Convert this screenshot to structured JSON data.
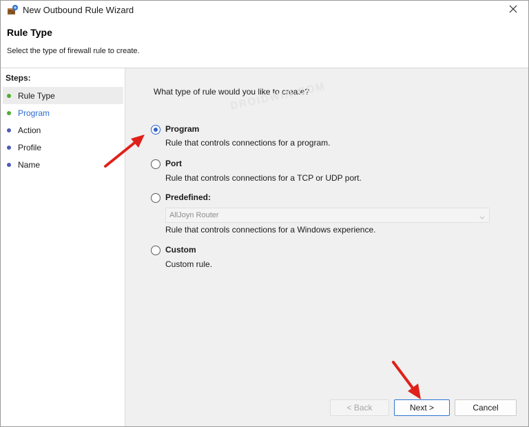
{
  "window": {
    "title": "New Outbound Rule Wizard"
  },
  "header": {
    "title": "Rule Type",
    "subtitle": "Select the type of firewall rule to create."
  },
  "steps": {
    "label": "Steps:",
    "items": [
      {
        "label": "Rule Type",
        "status": "current"
      },
      {
        "label": "Program",
        "status": "next"
      },
      {
        "label": "Action",
        "status": "pending"
      },
      {
        "label": "Profile",
        "status": "pending"
      },
      {
        "label": "Name",
        "status": "pending"
      }
    ]
  },
  "content": {
    "question": "What type of rule would you like to create?",
    "watermark": "DROIDWIN.COM",
    "options": [
      {
        "label": "Program",
        "description": "Rule that controls connections for a program.",
        "checked": true
      },
      {
        "label": "Port",
        "description": "Rule that controls connections for a TCP or UDP port.",
        "checked": false
      },
      {
        "label": "Predefined:",
        "description": "Rule that controls connections for a Windows experience.",
        "checked": false
      },
      {
        "label": "Custom",
        "description": "Custom rule.",
        "checked": false
      }
    ],
    "predefined_select": {
      "value": "AllJoyn Router",
      "disabled": true
    }
  },
  "buttons": {
    "back": "< Back",
    "next": "Next >",
    "cancel": "Cancel"
  },
  "colors": {
    "accent": "#2e64c7",
    "step_done": "#4caf2f",
    "step_pending": "#4e5bb5",
    "annotation_arrow": "#e0201b"
  },
  "icons": {
    "app": "firewall-wizard-icon",
    "close": "close-icon",
    "dropdown": "chevron-down-icon"
  }
}
